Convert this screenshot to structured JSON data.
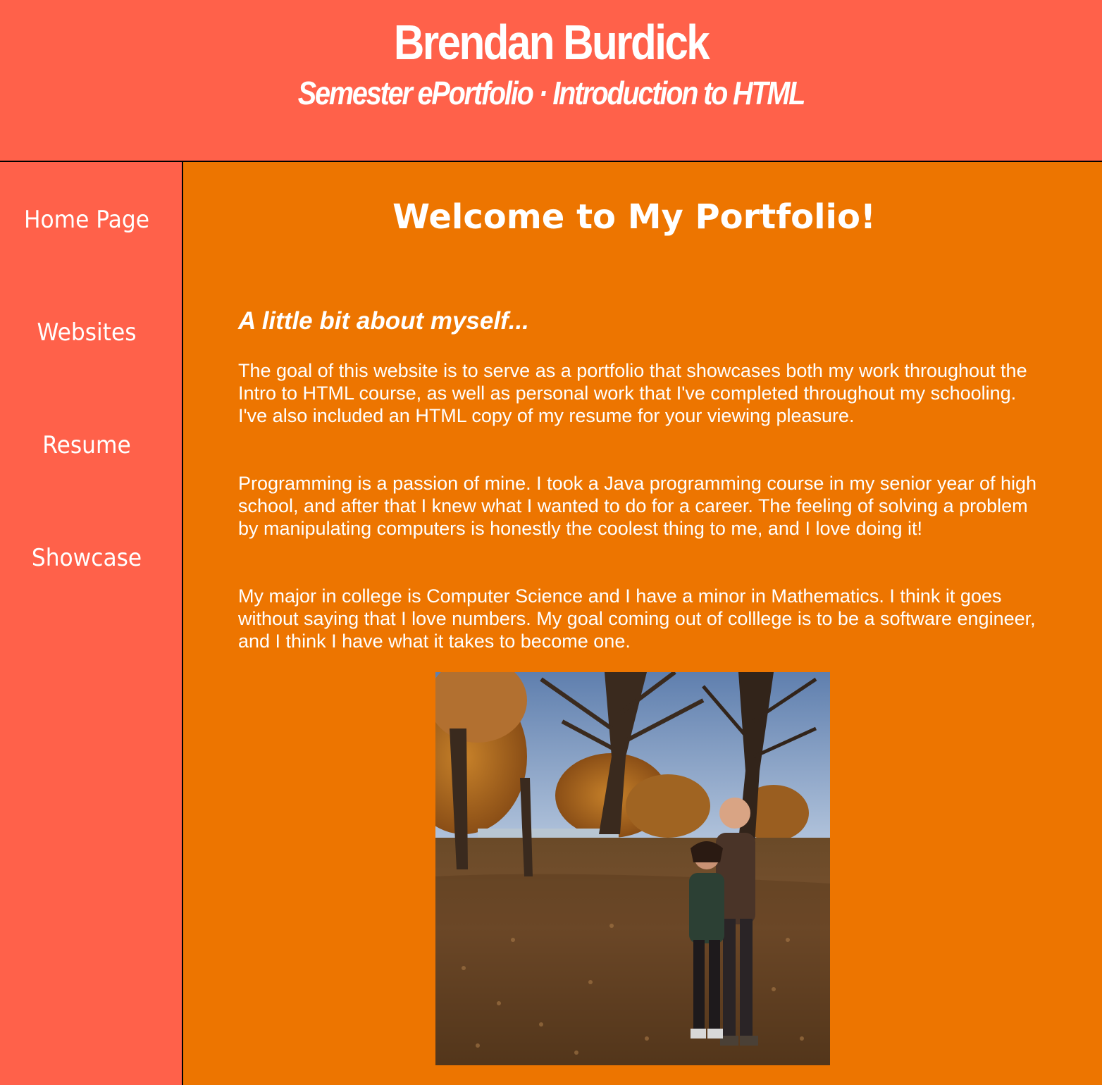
{
  "header": {
    "title": "Brendan Burdick",
    "subtitle": "Semester ePortfolio · Introduction to HTML"
  },
  "sidebar": {
    "items": [
      {
        "label": "Home Page"
      },
      {
        "label": "Websites"
      },
      {
        "label": "Resume"
      },
      {
        "label": "Showcase"
      }
    ]
  },
  "main": {
    "welcome": "Welcome to My Portfolio!",
    "about_heading": "A little bit about myself...",
    "paragraphs": [
      "The goal of this website is to serve as a portfolio that showcases both my work throughout the Intro to HTML course, as well as personal work that I've completed throughout my schooling. I've also included an HTML copy of my resume for your viewing pleasure.",
      "Programming is a passion of mine. I took a Java programming course in my senior year of high school, and after that I knew what I wanted to do for a career. The feeling of solving a problem by manipulating computers is honestly the coolest thing to me, and I love doing it!",
      "My major in college is Computer Science and I have a minor in Mathematics. I think it goes without saying that I love numbers. My goal coming out of colllege is to be a software engineer, and I think I have what it takes to become one."
    ]
  },
  "colors": {
    "header_bg": "#ff614a",
    "sidebar_bg": "#ff614a",
    "main_bg": "#ed7500",
    "text": "#ffffff"
  }
}
